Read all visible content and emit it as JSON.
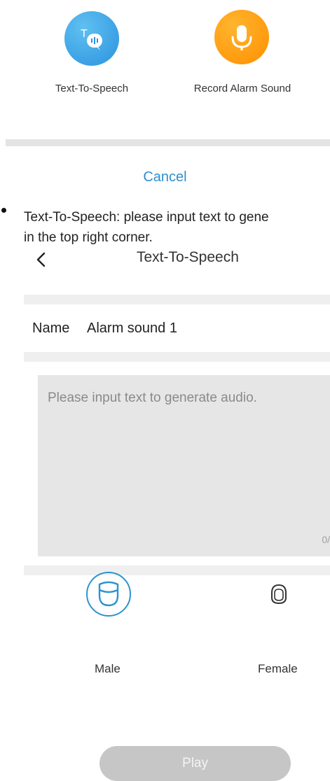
{
  "action_sheet": {
    "options": [
      {
        "label": "Text-To-Speech",
        "icon": "text-to-speech-icon",
        "color": "#2b93df"
      },
      {
        "label": "Record Alarm Sound",
        "icon": "microphone-icon",
        "color": "#ff9500"
      }
    ],
    "cancel_label": "Cancel",
    "cancel_color": "#2f8fcf"
  },
  "doc": {
    "line1": "Text-To-Speech: please input text to gene",
    "line2": "in the top right corner."
  },
  "tts_screen": {
    "back_icon": "chevron-left-icon",
    "title": "Text-To-Speech",
    "name_label": "Name",
    "name_value": "Alarm sound 1",
    "text_placeholder": "Please input text to generate audio.",
    "counter": "0/",
    "voices": [
      {
        "label": "Male",
        "icon": "male-face-icon",
        "selected": true
      },
      {
        "label": "Female",
        "icon": "female-face-icon",
        "selected": false
      }
    ],
    "play_label": "Play"
  }
}
